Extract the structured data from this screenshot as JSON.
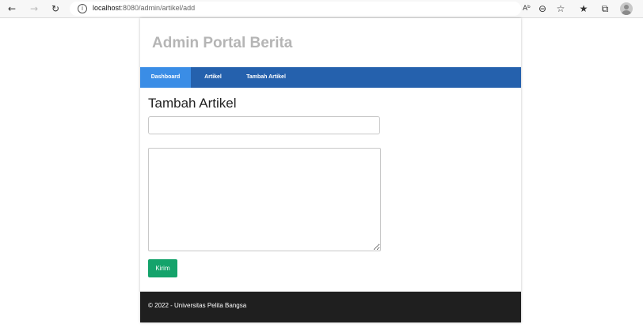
{
  "browser": {
    "url_host": "localhost",
    "url_path": ":8080/admin/artikel/add",
    "icons": [
      "back-icon",
      "forward-icon",
      "reload-icon",
      "info-icon",
      "read-aloud-icon",
      "zoom-icon",
      "add-favorite-icon",
      "favorites-icon",
      "collections-icon",
      "profile-icon"
    ]
  },
  "site": {
    "title": "Admin Portal Berita"
  },
  "nav": {
    "items": [
      {
        "label": "Dashboard",
        "active": true
      },
      {
        "label": "Artikel",
        "active": false
      },
      {
        "label": "Tambah Artikel",
        "active": false
      }
    ]
  },
  "form": {
    "heading": "Tambah Artikel",
    "title_value": "",
    "content_value": "",
    "submit_label": "Kirim"
  },
  "footer": {
    "text": "© 2022 - Universitas Pelita Bangsa"
  },
  "colors": {
    "nav_bg": "#2561ad",
    "nav_active": "#3a8de6",
    "submit": "#14a36b",
    "footer_bg": "#1f1f1f",
    "title": "#b5b5b5"
  }
}
